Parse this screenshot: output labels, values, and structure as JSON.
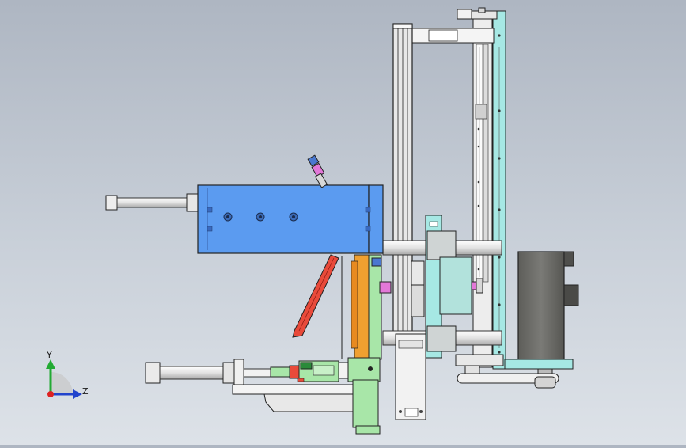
{
  "view": {
    "background_top": "#aeb6c2",
    "background_bottom": "#dde2e8"
  },
  "triad": {
    "y_label": "Y",
    "z_label": "Z",
    "y_color": "#22aa33",
    "z_color": "#2244cc",
    "x_color": "#dd2222"
  },
  "colors": {
    "cylinder_blue": "#5b9bf0",
    "plate_cyan": "#a6e8e4",
    "plate_green": "#a8e6a8",
    "bracket_orange": "#f0a030",
    "arm_red": "#e84a3a",
    "motor_gray": "#6a6a66",
    "rail_white": "#f1f1f1",
    "fitting_pink": "#e278d8"
  }
}
